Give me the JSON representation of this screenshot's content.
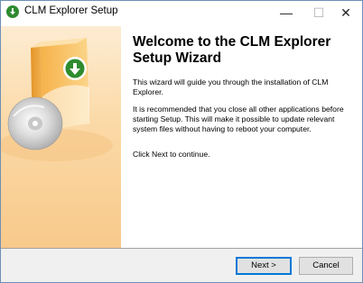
{
  "window": {
    "title": "CLM Explorer Setup",
    "controls": {
      "minimize": "—",
      "maximize": "☐",
      "close": "✕"
    }
  },
  "content": {
    "heading": "Welcome to the CLM Explorer Setup Wizard",
    "paragraphs": [
      "This wizard will guide you through the installation of CLM Explorer.",
      "It is recommended that you close all other applications before starting Setup. This will make it possible to update relevant system files without having to reboot your computer.",
      "Click Next to continue."
    ]
  },
  "buttons": {
    "next": "Next >",
    "cancel": "Cancel"
  },
  "icons": {
    "app": "download-arrow-icon",
    "banner": "software-box-cd-icon"
  }
}
